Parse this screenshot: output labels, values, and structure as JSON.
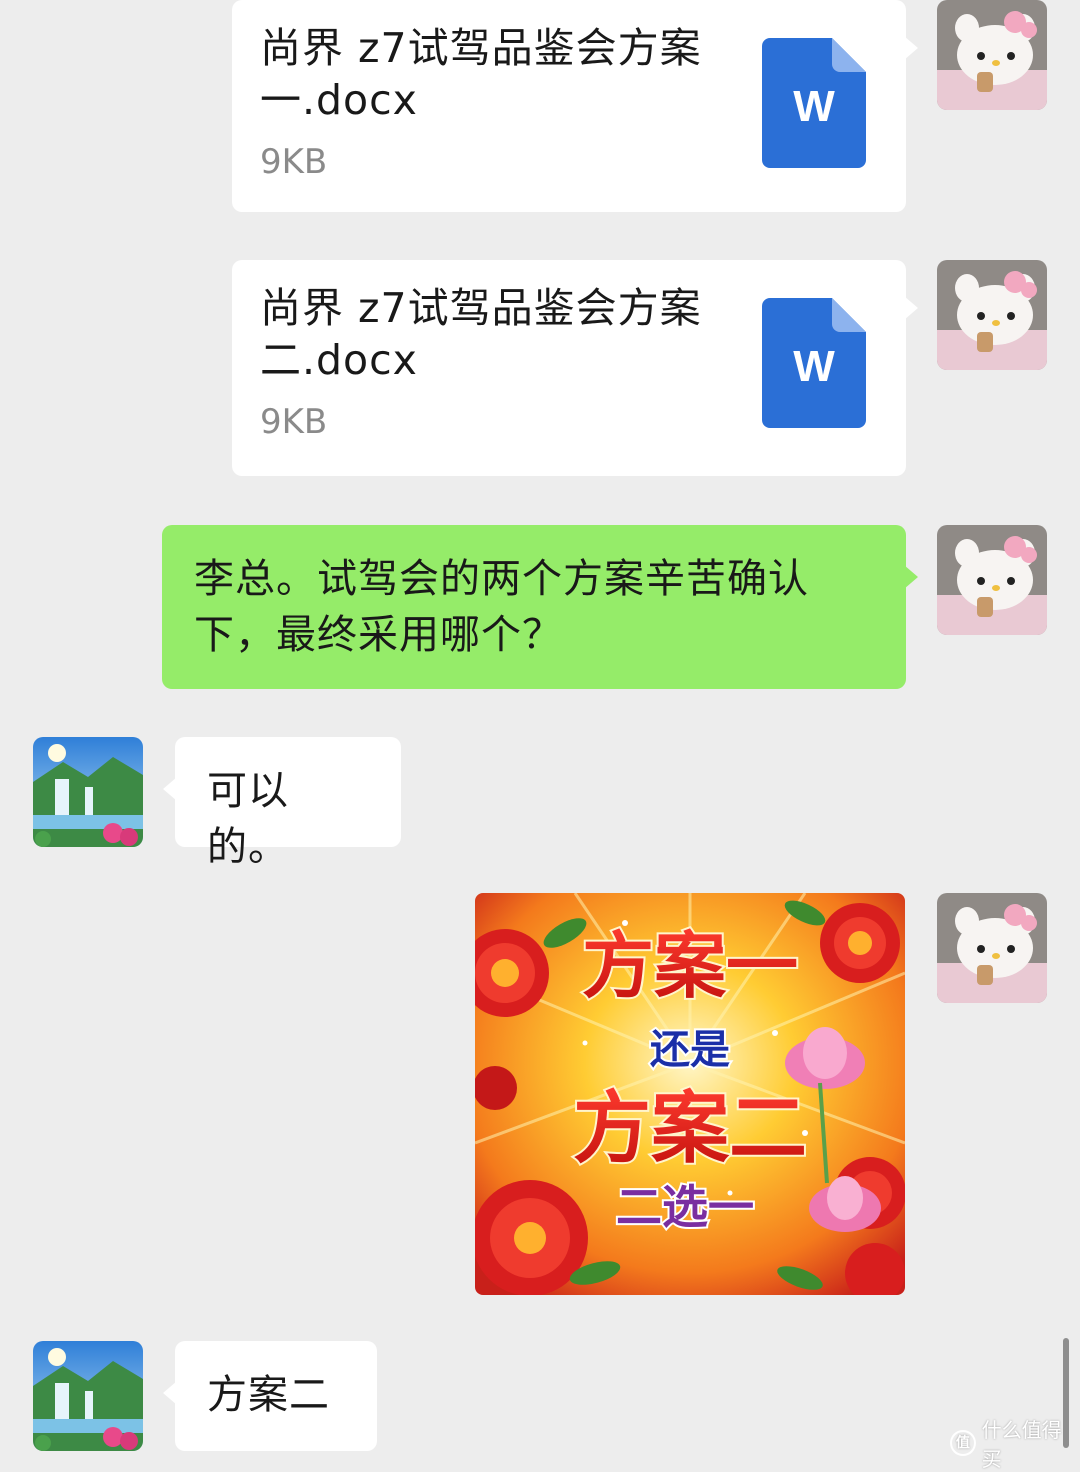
{
  "messages": [
    {
      "type": "file",
      "side": "right",
      "file_name": "尚界 z7试驾品鉴会方案一.docx",
      "file_size": "9KB",
      "file_icon": "word-doc-icon",
      "icon_letter": "W"
    },
    {
      "type": "file",
      "side": "right",
      "file_name": "尚界 z7试驾品鉴会方案二.docx",
      "file_size": "9KB",
      "file_icon": "word-doc-icon",
      "icon_letter": "W"
    },
    {
      "type": "text",
      "side": "right",
      "text": "李总。试驾会的两个方案辛苦确认下，最终采用哪个？"
    },
    {
      "type": "text",
      "side": "left",
      "text": "可以的。"
    },
    {
      "type": "image",
      "side": "right",
      "image_text": {
        "line1": "方案一",
        "line2": "还是",
        "line3": "方案二",
        "line4": "二选一"
      }
    },
    {
      "type": "text",
      "side": "left",
      "text": "方案二"
    }
  ],
  "avatars": {
    "self": "hello-kitty-avatar",
    "contact": "waterfall-landscape-avatar"
  },
  "watermark": {
    "icon_text": "值",
    "text": "什么值得买"
  },
  "colors": {
    "background": "#ededed",
    "self_bubble": "#95ec69",
    "other_bubble": "#ffffff",
    "word_icon": "#2b6fd6"
  }
}
